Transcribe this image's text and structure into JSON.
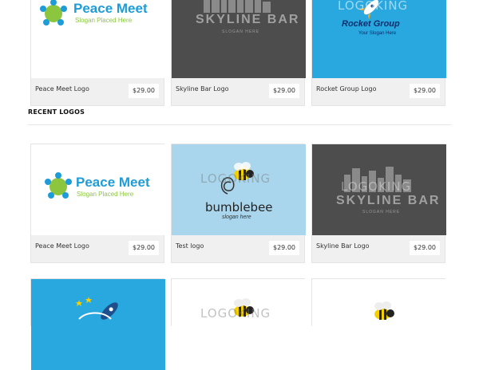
{
  "top_row": [
    {
      "name": "Peace Meet Logo",
      "price": "$29.00"
    },
    {
      "name": "Skyline Bar Logo",
      "price": "$29.00"
    },
    {
      "name": "Rocket Group Logo",
      "price": "$29.00"
    }
  ],
  "section": {
    "title": "RECENT LOGOS"
  },
  "recent_row": [
    {
      "name": "Peace Meet Logo",
      "price": "$29.00"
    },
    {
      "name": "Test logo",
      "price": "$29.00"
    },
    {
      "name": "Skyline Bar Logo",
      "price": "$29.00"
    }
  ],
  "logos": {
    "peace_title": "Peace Meet",
    "peace_slogan": "Slogan Placed Here",
    "skyline_title": "SKYLINE BAR",
    "skyline_slogan": "SLOGAN HERE",
    "rocket_title": "Rocket Group",
    "rocket_slogan": "Your Slogan Here",
    "bee_title": "bumblebee",
    "bee_slogan": "slogan here",
    "watermark": "LOGOKING"
  },
  "colors": {
    "peace_blue": "#1e9cd7",
    "peace_green": "#8cc63f",
    "skyline_bg": "#4d4d4d",
    "rocket_bg": "#28a8df",
    "bee_bg": "#a9d6ec"
  }
}
